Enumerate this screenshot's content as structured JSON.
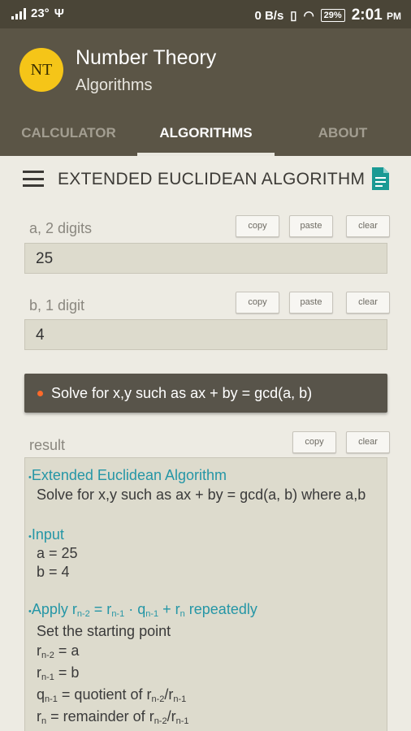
{
  "status": {
    "signal": "23°",
    "data_rate": "0 B/s",
    "battery": "29%",
    "time": "2:01",
    "ampm": "PM"
  },
  "app": {
    "logo": "NT",
    "title": "Number Theory",
    "subtitle": "Algorithms"
  },
  "tabs": [
    {
      "label": "CALCULATOR",
      "active": false
    },
    {
      "label": "ALGORITHMS",
      "active": true
    },
    {
      "label": "ABOUT",
      "active": false
    }
  ],
  "toolbar": {
    "title": "EXTENDED EUCLIDEAN ALGORITHM"
  },
  "input_a": {
    "label": "a, 2 digits",
    "value": "25",
    "buttons": [
      "copy",
      "paste",
      "clear"
    ]
  },
  "input_b": {
    "label": "b, 1 digit",
    "value": "4",
    "buttons": [
      "copy",
      "paste",
      "clear"
    ]
  },
  "solve_button": {
    "label": "Solve for x,y such as ax + by = gcd(a, b)"
  },
  "result": {
    "label": "result",
    "buttons": [
      "copy",
      "clear"
    ],
    "heading1": "Extended Euclidean Algorithm",
    "line1": "Solve for x,y such as ax + by = gcd(a, b) where a,b",
    "heading2": "Input",
    "input_a": "a = 25",
    "input_b": "b = 4",
    "heading3": {
      "pre": "Apply r",
      "s1": "n-2",
      "eq": " = r",
      "s2": "n-1",
      "dot": " · q",
      "s3": "n-1",
      "plus": " + r",
      "s4": "n",
      "post": " repeatedly"
    },
    "set_start": "Set the starting point",
    "rn2": {
      "r": "r",
      "sub": "n-2",
      "rest": " = a"
    },
    "rn1": {
      "r": "r",
      "sub": "n-1",
      "rest": " = b"
    },
    "qn1": {
      "q": "q",
      "sub": "n-1",
      "mid": " = quotient of r",
      "sub2": "n-2",
      "slash": "/r",
      "sub3": "n-1"
    },
    "rn": {
      "r": "r",
      "sub": "n",
      "mid": " = remainder of r",
      "sub2": "n-2",
      "slash": "/r",
      "sub3": "n-1"
    }
  },
  "colors": {
    "appbar": "#5b5546",
    "accent_text": "#2596a6",
    "logo_bg": "#f5c518",
    "solve_dot": "#ff6a2a"
  }
}
